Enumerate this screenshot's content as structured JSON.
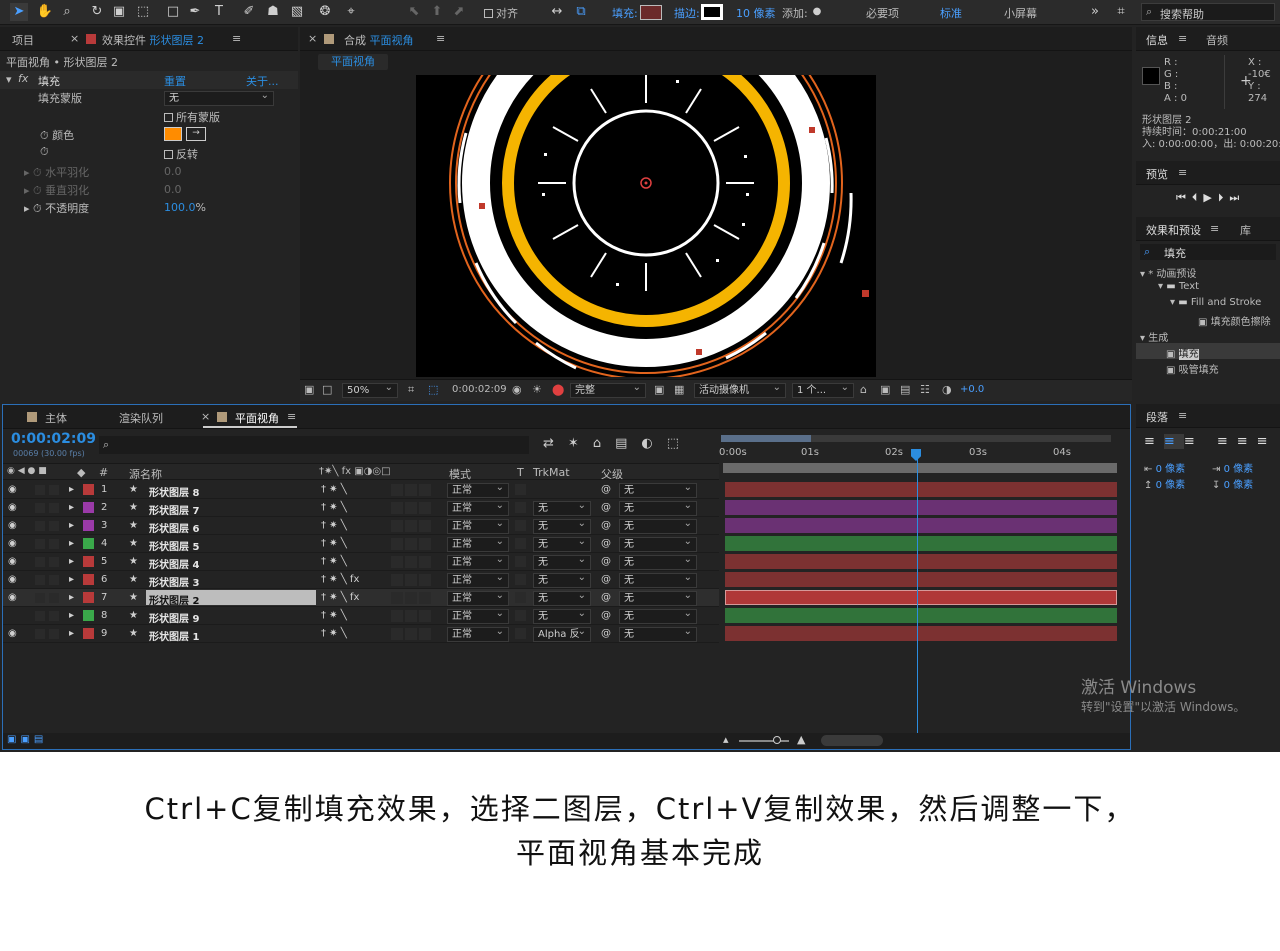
{
  "toolbar": {
    "align_label": "对齐",
    "fill_label": "填充:",
    "stroke_label": "描边:",
    "stroke_width": "10 像素",
    "add_label": "添加:",
    "workspaces": [
      "必要项",
      "标准",
      "小屏幕"
    ],
    "active_workspace": "标准",
    "search_placeholder": "搜索帮助",
    "fill_color": "#6b2a2a"
  },
  "effect_controls": {
    "tabs": [
      "项目",
      "效果控件 形状图层 2"
    ],
    "tab_project": "项目",
    "tab_effect_prefix": "效果控件",
    "tab_effect_layer": "形状图层 2",
    "breadcrumb": "平面视角 • 形状图层 2",
    "fx_name": "填充",
    "reset": "重置",
    "about": "关于...",
    "fill_mask_label": "填充蒙版",
    "fill_mask_value": "无",
    "all_masks": "所有蒙版",
    "color_label": "颜色",
    "color_value": "#ff8c00",
    "invert": "反转",
    "h_feather": "水平羽化",
    "h_feather_value": "0.0",
    "v_feather": "垂直羽化",
    "v_feather_value": "0.0",
    "opacity": "不透明度",
    "opacity_value": "100.0",
    "opacity_unit": "%"
  },
  "composition": {
    "tab_prefix": "合成",
    "tab_name": "平面视角",
    "subtab": "平面视角",
    "zoom": "50%",
    "timecode": "0:00:02:09",
    "quality": "完整",
    "camera": "活动摄像机",
    "views": "1 个...",
    "exposure": "+0.0"
  },
  "info": {
    "tab_info": "信息",
    "tab_audio": "音频",
    "r": "R :",
    "g": "G :",
    "b": "B :",
    "a": "A : 0",
    "x": "X : -10€",
    "y": "Y : 274",
    "layer": "形状图层 2",
    "duration": "持续时间：0:00:21:00",
    "inout": "入: 0:00:00:00，出: 0:00:20:"
  },
  "preview": {
    "title": "预览"
  },
  "effects_presets": {
    "tab": "效果和预设",
    "tab_lib": "库",
    "search": "填充",
    "tree": [
      {
        "label": "* 动画预设",
        "indent": 0
      },
      {
        "label": "Text",
        "indent": 1
      },
      {
        "label": "Fill and Stroke",
        "indent": 2
      },
      {
        "label": "填充颜色擦除",
        "indent": 3
      },
      {
        "label": "生成",
        "indent": 0
      },
      {
        "label": "填充",
        "indent": 1
      },
      {
        "label": "吸管填充",
        "indent": 1
      }
    ]
  },
  "paragraph": {
    "title": "段落",
    "v1": "0 像素",
    "v2": "0 像素",
    "v3": "0 像素",
    "v4": "0 像素"
  },
  "timeline": {
    "tabs": [
      "主体",
      "渲染队列",
      "平面视角"
    ],
    "timecode": "0:00:02:09",
    "fps": "00069 (30.00 fps)",
    "headers": {
      "num": "#",
      "name": "源名称",
      "mode": "模式",
      "t": "T",
      "trkmat": "TrkMat",
      "parent": "父级"
    },
    "ruler": [
      "0:00s",
      "01s",
      "02s",
      "03s",
      "04s"
    ],
    "layers": [
      {
        "num": "1",
        "name": "形状图层 8",
        "color": "#b83a3a",
        "mode": "正常",
        "trk": "",
        "parent": "无",
        "fx": false
      },
      {
        "num": "2",
        "name": "形状图层 7",
        "color": "#9a3aa8",
        "mode": "正常",
        "trk": "无",
        "parent": "无",
        "fx": false
      },
      {
        "num": "3",
        "name": "形状图层 6",
        "color": "#9a3aa8",
        "mode": "正常",
        "trk": "无",
        "parent": "无",
        "fx": false
      },
      {
        "num": "4",
        "name": "形状图层 5",
        "color": "#3aa84a",
        "mode": "正常",
        "trk": "无",
        "parent": "无",
        "fx": false
      },
      {
        "num": "5",
        "name": "形状图层 4",
        "color": "#b83a3a",
        "mode": "正常",
        "trk": "无",
        "parent": "无",
        "fx": false
      },
      {
        "num": "6",
        "name": "形状图层 3",
        "color": "#b83a3a",
        "mode": "正常",
        "trk": "无",
        "parent": "无",
        "fx": true
      },
      {
        "num": "7",
        "name": "形状图层 2",
        "color": "#b83a3a",
        "mode": "正常",
        "trk": "无",
        "parent": "无",
        "fx": true
      },
      {
        "num": "8",
        "name": "形状图层 9",
        "color": "#3aa84a",
        "mode": "正常",
        "trk": "无",
        "parent": "无",
        "fx": false
      },
      {
        "num": "9",
        "name": "形状图层 1",
        "color": "#b83a3a",
        "mode": "正常",
        "trk": "Alpha 反",
        "parent": "无",
        "fx": false
      }
    ]
  },
  "watermark": {
    "line1": "激活 Windows",
    "line2": "转到\"设置\"以激活 Windows。"
  },
  "caption": {
    "line1": "Ctrl+C复制填充效果，选择二图层，Ctrl+V复制效果，然后调整一下，",
    "line2": "平面视角基本完成"
  }
}
